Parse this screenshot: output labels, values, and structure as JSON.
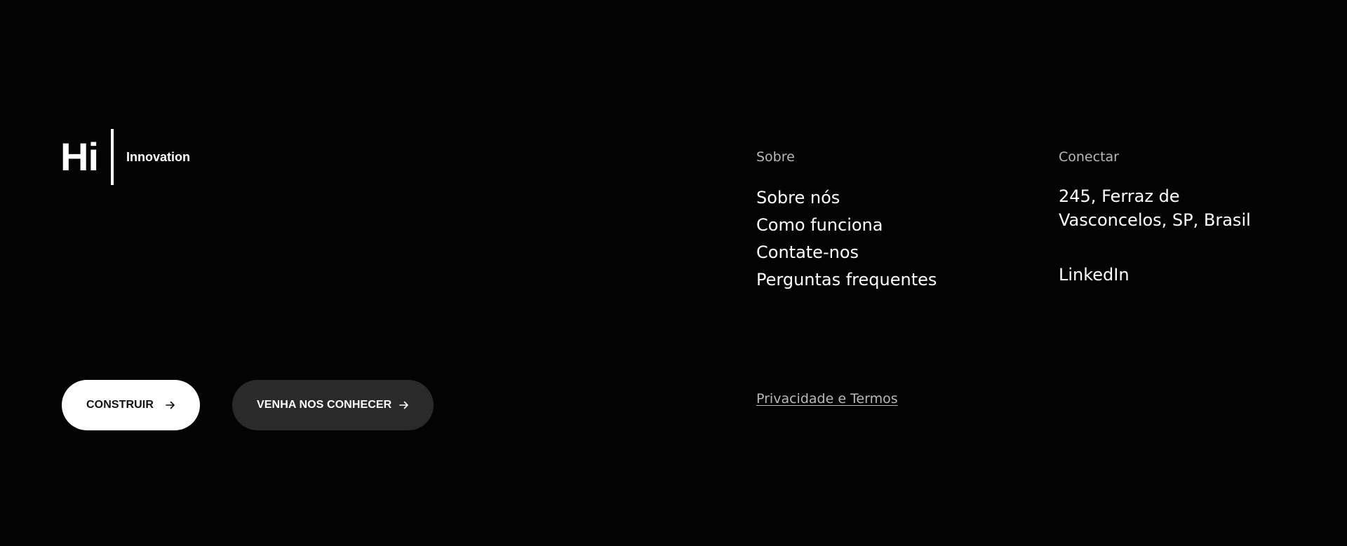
{
  "brand": {
    "mark": "Hi",
    "name": "Innovation"
  },
  "buttons": {
    "build_label": "CONSTRUIR",
    "meet_label": "VENHA NOS CONHECER"
  },
  "about": {
    "heading": "Sobre",
    "links": [
      "Sobre nós",
      "Como funciona",
      "Contate-nos",
      "Perguntas frequentes"
    ]
  },
  "connect": {
    "heading": "Conectar",
    "address": "245, Ferraz de Vasconcelos, SP, Brasil",
    "linkedin": "LinkedIn"
  },
  "legal": {
    "privacy_label": "Privacidade e Termos"
  },
  "colors": {
    "background": "#030303",
    "primary_button": "#ffffff",
    "secondary_button": "#2a2a2a",
    "muted_text": "#b9b9b9"
  },
  "icons": {
    "button_arrow": "arrow-right-icon"
  }
}
